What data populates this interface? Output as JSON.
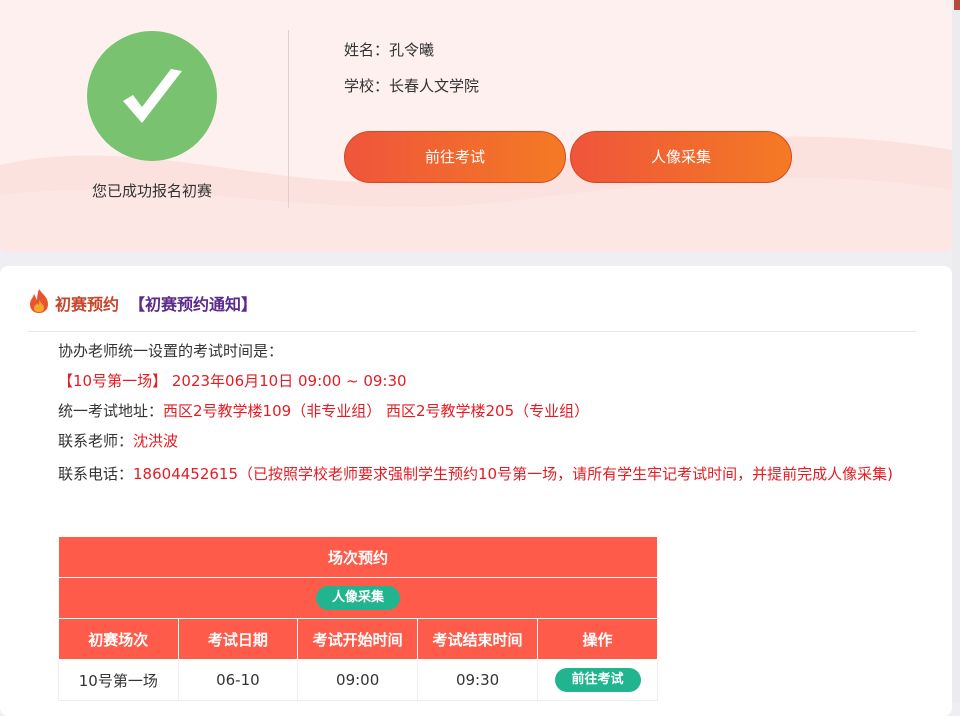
{
  "profile": {
    "success_text": "您已成功报名初赛",
    "name_label": "姓名：",
    "name_value": "孔令曦",
    "school_label": "学校：",
    "school_value": "长春人文学院",
    "exam_button": "前往考试",
    "photo_button": "人像采集"
  },
  "section": {
    "title": "初赛预约",
    "notice": "【初赛预约通知】"
  },
  "info": {
    "intro": "协办老师统一设置的考试时间是：",
    "session_tag": "【10号第一场】",
    "session_time": "2023年06月10日 09:00 ~ 09:30",
    "address_label": "统一考试地址：",
    "address_value": "西区2号教学楼109（非专业组） 西区2号教学楼205（专业组）",
    "teacher_label": "联系老师：",
    "teacher_value": "沈洪波",
    "phone_label": "联系电话：",
    "phone_value": "18604452615（已按照学校老师要求强制学生预约10号第一场，请所有学生牢记考试时间，并提前完成人像采集)"
  },
  "table": {
    "title": "场次预约",
    "photo_button": "人像采集",
    "headers": [
      "初赛场次",
      "考试日期",
      "考试开始时间",
      "考试结束时间",
      "操作"
    ],
    "rows": [
      {
        "session": "10号第一场",
        "date": "06-10",
        "start": "09:00",
        "end": "09:30",
        "action": "前往考试"
      }
    ]
  },
  "colors": {
    "accent_red": "#ff5b4a",
    "success_green": "#79c26f",
    "pill_green": "#20b58f",
    "notice_purple": "#5b2a8c"
  }
}
